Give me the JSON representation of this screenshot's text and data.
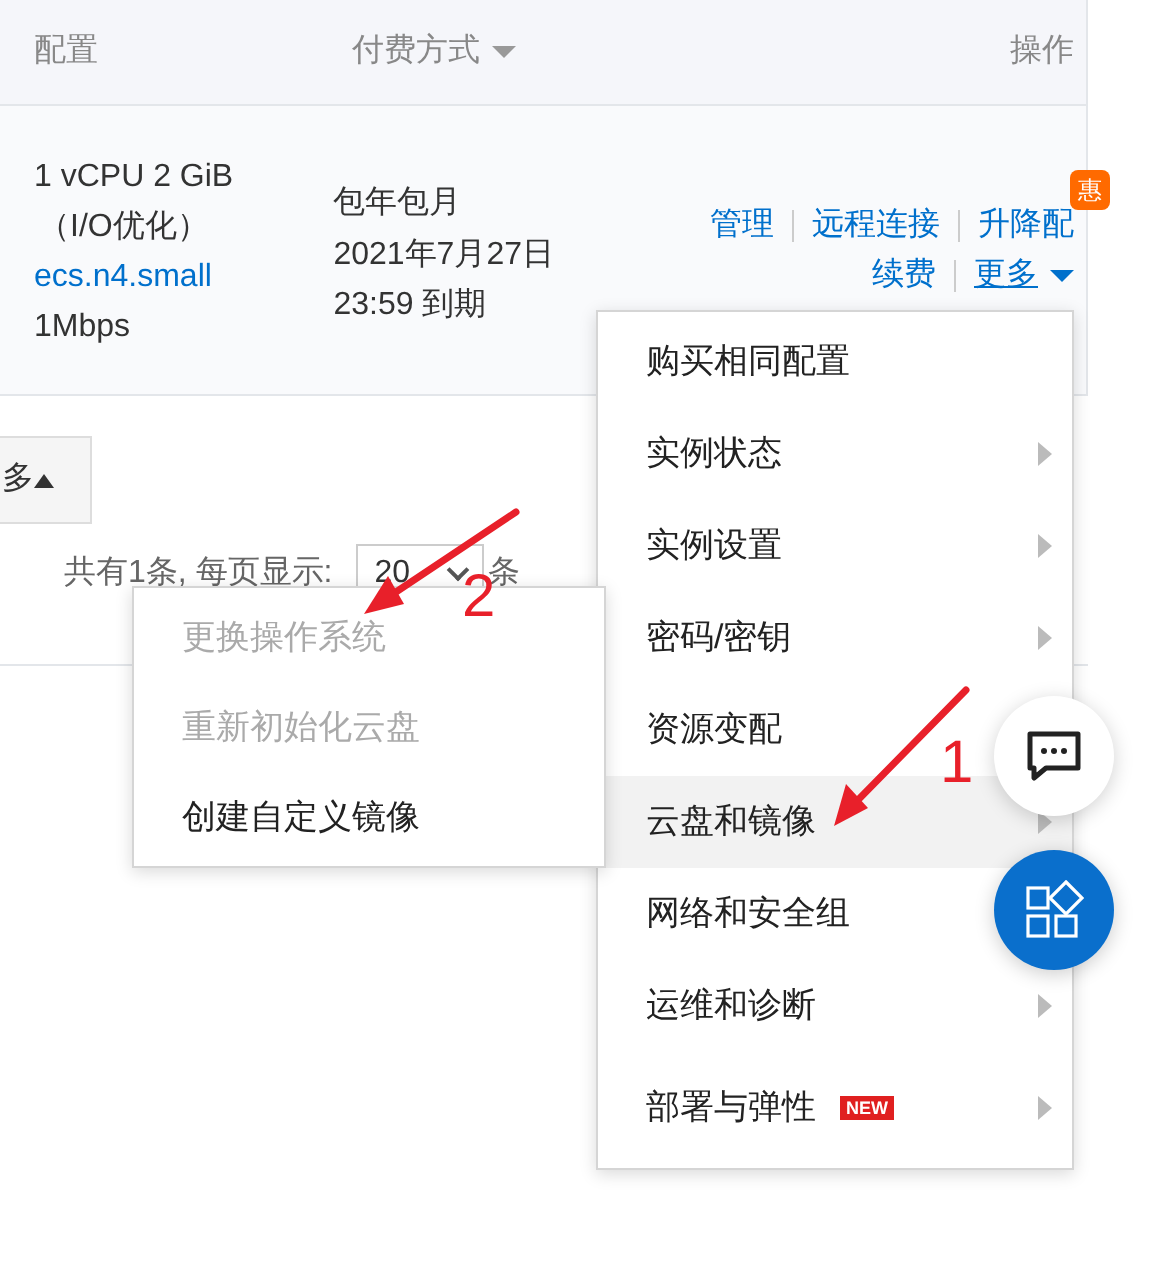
{
  "table": {
    "columns": [
      {
        "label": "配置",
        "sortable": false
      },
      {
        "label": "付费方式",
        "sortable": true
      },
      {
        "label": "操作",
        "sortable": false
      }
    ],
    "rows": [
      {
        "config": [
          "1 vCPU 2 GiB",
          "（I/O优化）"
        ],
        "instance_type": "ecs.n4.small",
        "bandwidth": "1Mbps",
        "billing": [
          "包年包月",
          "2021年7月27日",
          "23:59 到期"
        ],
        "action_lines": [
          [
            "管理",
            "远程连接",
            "升降配"
          ],
          [
            "续费",
            "更多"
          ]
        ],
        "promo_badge": "惠"
      }
    ]
  },
  "more_button": {
    "label": "多"
  },
  "pagination": {
    "summary": "共有1条, 每页显示:",
    "page_size": "20",
    "unit": "条"
  },
  "menu": {
    "items": [
      {
        "label": "购买相同配置",
        "has_submenu": false,
        "selected": false
      },
      {
        "label": "实例状态",
        "has_submenu": true,
        "selected": false
      },
      {
        "label": "实例设置",
        "has_submenu": true,
        "selected": false
      },
      {
        "label": "密码/密钥",
        "has_submenu": true,
        "selected": false
      },
      {
        "label": "资源变配",
        "has_submenu": false,
        "selected": false
      },
      {
        "label": "云盘和镜像",
        "has_submenu": true,
        "selected": true
      },
      {
        "label": "网络和安全组",
        "has_submenu": false,
        "selected": false
      },
      {
        "label": "运维和诊断",
        "has_submenu": true,
        "selected": false
      },
      {
        "label": "部署与弹性",
        "has_submenu": true,
        "selected": false,
        "badge": "NEW"
      }
    ]
  },
  "submenu": {
    "items": [
      {
        "label": "更换操作系统",
        "disabled": true
      },
      {
        "label": "重新初始化云盘",
        "disabled": true
      },
      {
        "label": "创建自定义镜像",
        "disabled": false
      }
    ]
  },
  "annotations": [
    {
      "label": "1"
    },
    {
      "label": "2"
    }
  ]
}
